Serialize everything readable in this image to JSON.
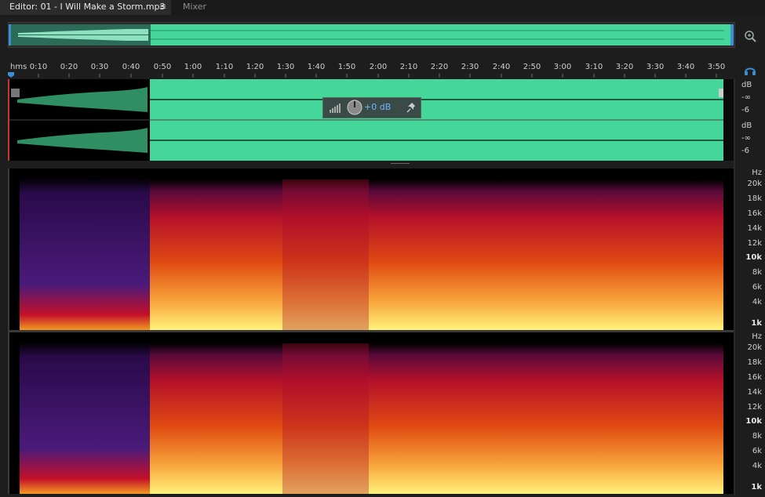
{
  "tabs": {
    "editor_label": "Editor: 01 - I Will Make a Storm.mp3",
    "editor_menu": "≡",
    "mixer_label": "Mixer"
  },
  "ruler": {
    "unit": "hms",
    "labels": [
      "0:10",
      "0:20",
      "0:30",
      "0:40",
      "0:50",
      "1:00",
      "1:10",
      "1:20",
      "1:30",
      "1:40",
      "1:50",
      "2:00",
      "2:10",
      "2:20",
      "2:30",
      "2:40",
      "2:50",
      "3:00",
      "3:10",
      "3:20",
      "3:30",
      "3:40",
      "3:50"
    ]
  },
  "waveform_scale": {
    "ch1": {
      "unit": "dB",
      "inf": "-∞",
      "minus6": "-6"
    },
    "ch2": {
      "unit": "dB",
      "inf": "-∞",
      "minus6": "-6"
    }
  },
  "gain_hud": {
    "value": "+0 dB"
  },
  "spectral_scale": {
    "unit": "Hz",
    "labels": [
      "20k",
      "18k",
      "16k",
      "14k",
      "12k",
      "10k",
      "8k",
      "6k",
      "4k",
      "1k"
    ]
  },
  "colors": {
    "waveform_selected": "#3ddc97",
    "waveform_unselected": "#1f7a4e",
    "waveform_bg_selected": "#45d69a",
    "accent_blue": "#3a8fd6"
  },
  "icons": {
    "zoom": "magnifier-zoom-icon",
    "headphones": "headphones-icon",
    "pin": "pin-icon"
  }
}
